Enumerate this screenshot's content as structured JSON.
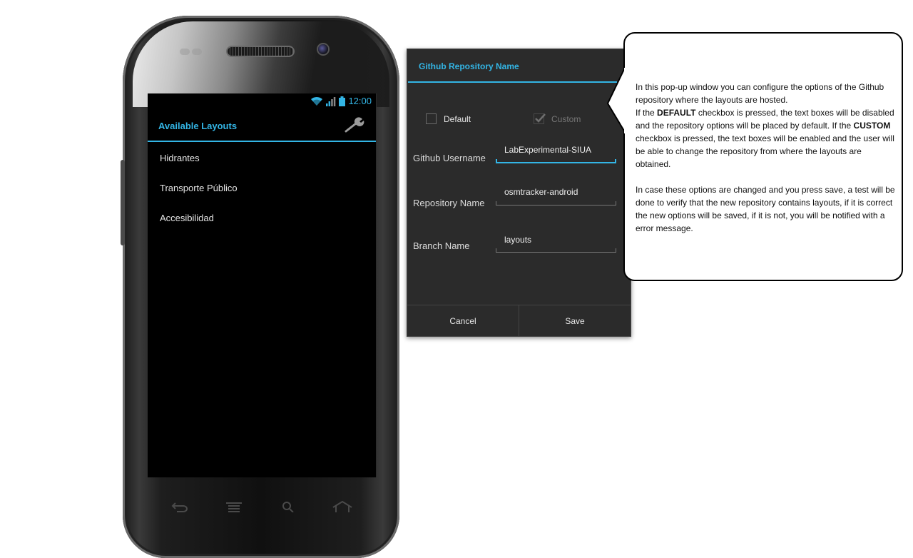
{
  "phone": {
    "status_time": "12:00",
    "action_bar_title": "Available Layouts",
    "layouts": [
      "Hidrantes",
      "Transporte Público",
      "Accesibilidad"
    ],
    "icons": [
      "wifi-icon",
      "signal-icon",
      "battery-icon",
      "wrench-icon",
      "back-icon",
      "menu-icon",
      "search-icon",
      "home-icon"
    ]
  },
  "dialog": {
    "title": "Github Repository Name",
    "default_label": "Default",
    "custom_label": "Custom",
    "default_checked": false,
    "custom_checked": true,
    "username_label": "Github Username",
    "username_value": "LabExperimental-SIUA",
    "repository_label": "Repository Name",
    "repository_value": "osmtracker-android",
    "branch_label": "Branch Name",
    "branch_value": "layouts",
    "cancel_label": "Cancel",
    "save_label": "Save"
  },
  "callout": {
    "line1": "In this pop-up window you can configure the options of the Github repository where the layouts are hosted.",
    "line2_prefix": "If the ",
    "line2_bold": "DEFAULT",
    "line2_suffix": " checkbox is pressed, the text boxes will be disabled and the repository options will be placed by default. If the ",
    "line2_bold2": "CUSTOM",
    "line2_suffix2": " checkbox is pressed, the text boxes will be enabled and the user will be able to change the repository from where the layouts are obtained.",
    "line3": "In case these options are changed and you press save, a test will be done to verify that the new repository contains layouts, if it is correct the new options will be saved, if it is not, you will be notified with a error message."
  },
  "colors": {
    "accent": "#33b5e5",
    "dialog_bg": "#2b2b2b",
    "screen_bg": "#000000"
  }
}
